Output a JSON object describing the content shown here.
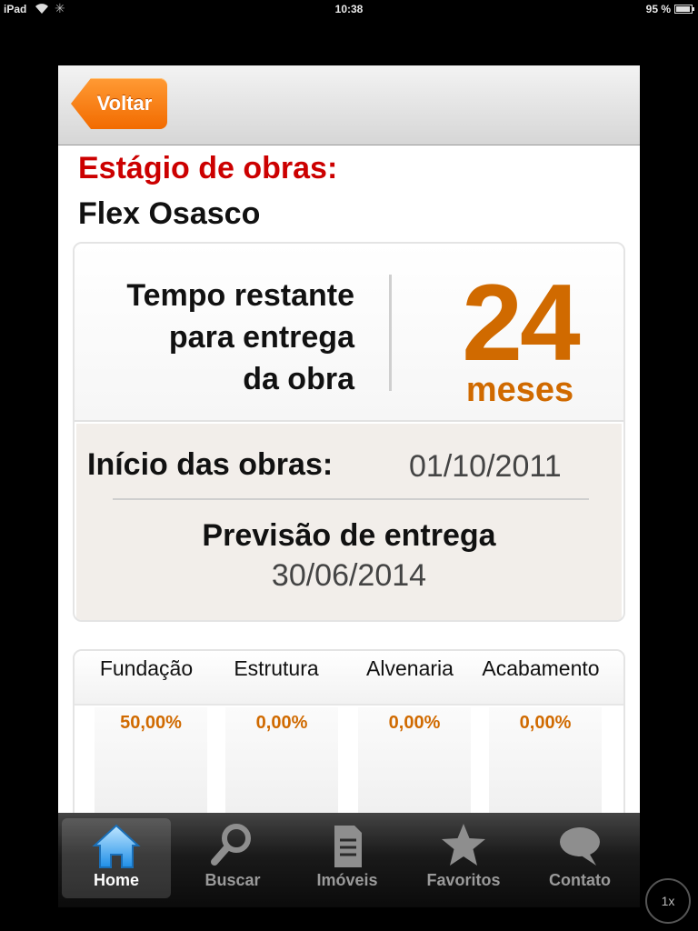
{
  "statusbar": {
    "device": "iPad",
    "time": "10:38",
    "battery": "95 %"
  },
  "navbar": {
    "back_label": "Voltar"
  },
  "page": {
    "title": "Estágio de obras:",
    "project": "Flex Osasco"
  },
  "countdown": {
    "label_lines": [
      "Tempo restante",
      "para  entrega",
      "da obra"
    ],
    "value": "24",
    "unit": "meses"
  },
  "dates": {
    "start_label": "Início das obras:",
    "start_value": "01/10/2011",
    "forecast_label": "Previsão de entrega",
    "forecast_value": "30/06/2014"
  },
  "stages": [
    {
      "name": "Fundação",
      "percent": "50,00%"
    },
    {
      "name": "Estrutura",
      "percent": "0,00%"
    },
    {
      "name": "Alvenaria",
      "percent": "0,00%"
    },
    {
      "name": "Acabamento",
      "percent": "0,00%"
    }
  ],
  "tabbar": {
    "items": [
      {
        "label": "Home",
        "icon": "home-icon",
        "active": true
      },
      {
        "label": "Buscar",
        "icon": "search-icon",
        "active": false
      },
      {
        "label": "Imóveis",
        "icon": "document-icon",
        "active": false
      },
      {
        "label": "Favoritos",
        "icon": "star-icon",
        "active": false
      },
      {
        "label": "Contato",
        "icon": "speech-bubble-icon",
        "active": false
      }
    ]
  },
  "zoom": {
    "label": "1x"
  },
  "colors": {
    "accent": "#d06a00",
    "title_red": "#cc0000",
    "back_button": "#f26b00"
  }
}
